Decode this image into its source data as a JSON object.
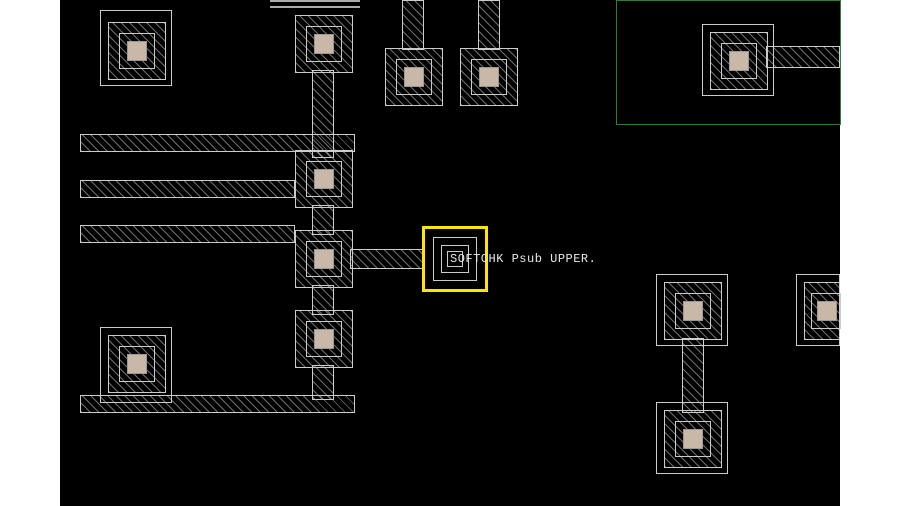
{
  "marker": {
    "label": "SOFTCHK Psub UPPER."
  },
  "layers": {
    "highlight_color": "#ffe600",
    "outline_color": "#cccccc",
    "via_fill": "#c9b8a8",
    "nwell_outline": "#2e7d32"
  }
}
